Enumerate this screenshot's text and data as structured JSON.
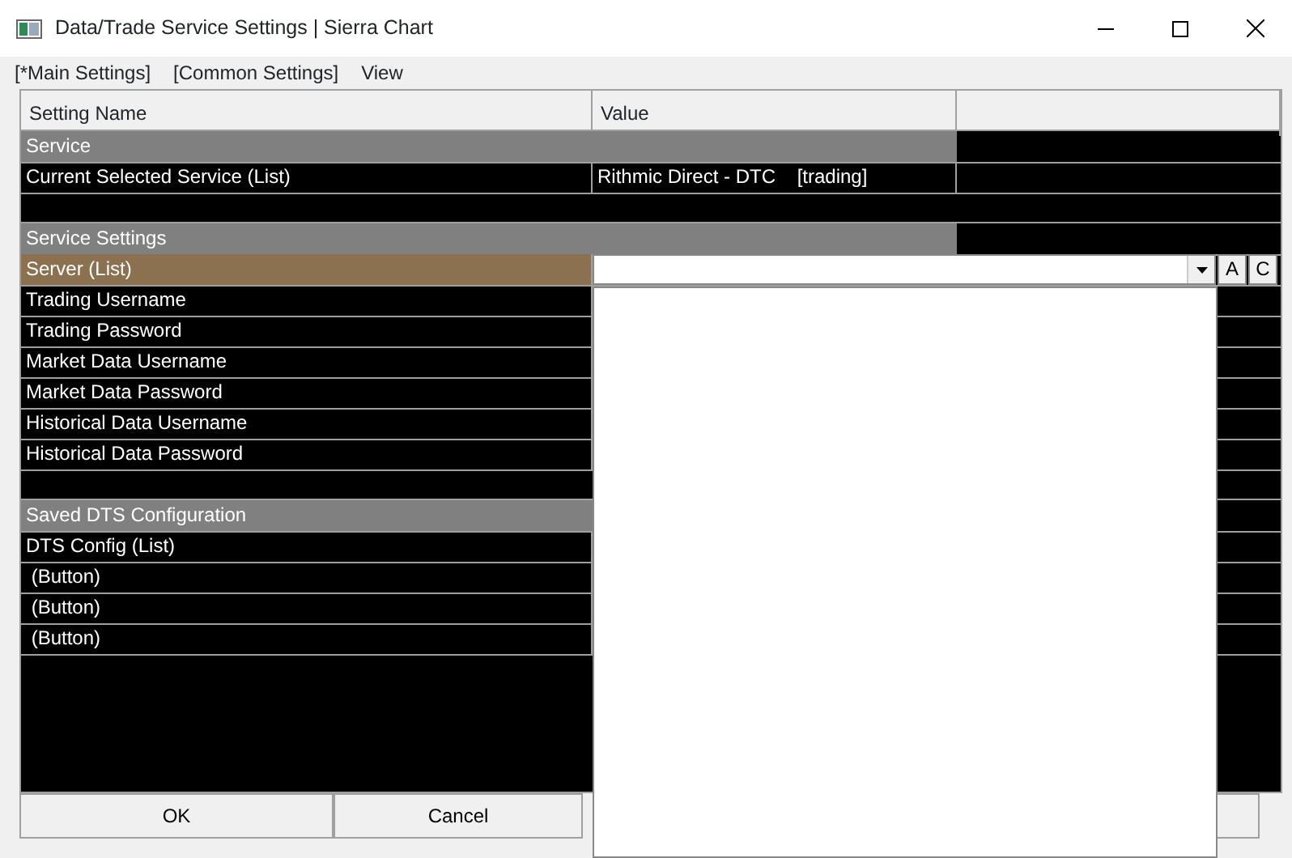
{
  "window": {
    "title": "Data/Trade Service Settings | Sierra Chart"
  },
  "menu": [
    {
      "label": "[*Main Settings]"
    },
    {
      "label": "[Common Settings]"
    },
    {
      "label": "View"
    }
  ],
  "table": {
    "columns": [
      "Setting Name",
      "Value"
    ],
    "rows": [
      {
        "kind": "group",
        "name": "Service"
      },
      {
        "kind": "setting",
        "name": "Current Selected Service (List)",
        "value": "Rithmic Direct - DTC    [trading]",
        "selected": false
      },
      {
        "kind": "blank"
      },
      {
        "kind": "group",
        "name": "Service Settings"
      },
      {
        "kind": "combo",
        "name": "Server (List)",
        "selected": true,
        "expanded": true,
        "side_buttons": [
          "A",
          "C"
        ]
      },
      {
        "kind": "setting",
        "name": "Trading Username",
        "selected": false
      },
      {
        "kind": "setting",
        "name": "Trading Password",
        "selected": false
      },
      {
        "kind": "setting",
        "name": "Market Data Username",
        "selected": false
      },
      {
        "kind": "setting",
        "name": "Market Data Password",
        "selected": false
      },
      {
        "kind": "setting",
        "name": "Historical Data Username",
        "selected": false
      },
      {
        "kind": "setting",
        "name": "Historical Data Password",
        "selected": false
      },
      {
        "kind": "blank"
      },
      {
        "kind": "group",
        "name": "Saved DTS Configuration"
      },
      {
        "kind": "setting",
        "name": "DTS Config (List)",
        "selected": false
      },
      {
        "kind": "setting",
        "name": " (Button)",
        "selected": false
      },
      {
        "kind": "setting",
        "name": " (Button)",
        "selected": false
      },
      {
        "kind": "setting",
        "name": " (Button)",
        "selected": false
      }
    ]
  },
  "buttons": [
    {
      "label": "OK"
    },
    {
      "label": "Cancel"
    },
    {
      "kind": "covered"
    }
  ]
}
